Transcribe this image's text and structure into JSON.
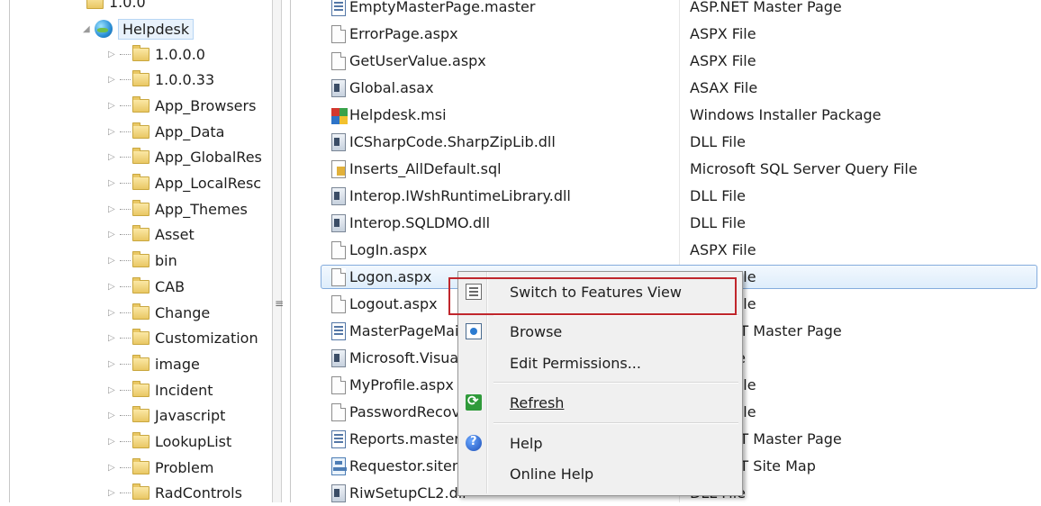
{
  "tree": {
    "partial_top_label": "1.0.0",
    "helpdesk_label": "Helpdesk",
    "items": [
      {
        "label": "1.0.0.0"
      },
      {
        "label": "1.0.0.33"
      },
      {
        "label": "App_Browsers"
      },
      {
        "label": "App_Data"
      },
      {
        "label": "App_GlobalRes"
      },
      {
        "label": "App_LocalResc"
      },
      {
        "label": "App_Themes"
      },
      {
        "label": "Asset"
      },
      {
        "label": "bin"
      },
      {
        "label": "CAB"
      },
      {
        "label": "Change"
      },
      {
        "label": "Customization"
      },
      {
        "label": "image"
      },
      {
        "label": "Incident"
      },
      {
        "label": "Javascript"
      },
      {
        "label": "LookupList"
      },
      {
        "label": "Problem"
      },
      {
        "label": "RadControls"
      }
    ]
  },
  "files": [
    {
      "name": "EmptyMasterPage.master",
      "type": "ASP.NET Master Page",
      "icon": "master-icon"
    },
    {
      "name": "ErrorPage.aspx",
      "type": "ASPX File",
      "icon": "document-icon"
    },
    {
      "name": "GetUserValue.aspx",
      "type": "ASPX File",
      "icon": "document-icon"
    },
    {
      "name": "Global.asax",
      "type": "ASAX File",
      "icon": "dll-icon"
    },
    {
      "name": "Helpdesk.msi",
      "type": "Windows Installer Package",
      "icon": "msi-icon"
    },
    {
      "name": "ICSharpCode.SharpZipLib.dll",
      "type": "DLL File",
      "icon": "dll-icon"
    },
    {
      "name": "Inserts_AllDefault.sql",
      "type": "Microsoft SQL Server Query File",
      "icon": "sql-icon"
    },
    {
      "name": "Interop.IWshRuntimeLibrary.dll",
      "type": "DLL File",
      "icon": "dll-icon"
    },
    {
      "name": "Interop.SQLDMO.dll",
      "type": "DLL File",
      "icon": "dll-icon"
    },
    {
      "name": "LogIn.aspx",
      "type": "ASPX File",
      "icon": "document-icon"
    },
    {
      "name": "Logon.aspx",
      "type": "ASPX File",
      "icon": "document-icon"
    },
    {
      "name": "Logout.aspx",
      "type": "ASPX File",
      "icon": "document-icon"
    },
    {
      "name": "MasterPageMain.master",
      "type": "ASP.NET Master Page",
      "icon": "master-icon"
    },
    {
      "name": "Microsoft.Visual.dll",
      "type": "DLL File",
      "icon": "dll-icon"
    },
    {
      "name": "MyProfile.aspx",
      "type": "ASPX File",
      "icon": "document-icon"
    },
    {
      "name": "PasswordRecovery.aspx",
      "type": "ASPX File",
      "icon": "document-icon"
    },
    {
      "name": "Reports.master",
      "type": "ASP.NET Master Page",
      "icon": "master-icon"
    },
    {
      "name": "Requestor.sitemap",
      "type": "ASP.NET Site Map",
      "icon": "sitemap-icon"
    },
    {
      "name": "RiwSetupCL2.dll",
      "type": "DLL File",
      "icon": "dll-icon"
    }
  ],
  "context_menu": {
    "switch_label": "Switch to Features View",
    "browse_label": "Browse",
    "edit_permissions_label": "Edit Permissions...",
    "refresh_label": "Refresh",
    "help_label": "Help",
    "online_help_label": "Online Help"
  }
}
